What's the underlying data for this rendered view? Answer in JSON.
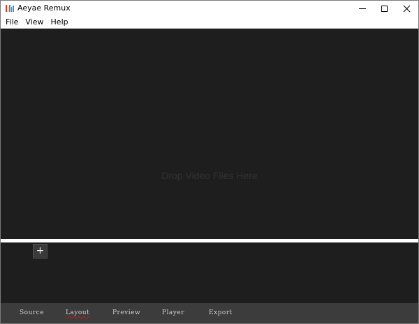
{
  "window": {
    "title": "Aeyae Remux",
    "icon": "app-icon",
    "controls": {
      "minimize": "minimize-icon",
      "maximize": "maximize-icon",
      "close": "close-icon"
    }
  },
  "menu": {
    "items": [
      {
        "label": "File"
      },
      {
        "label": "View"
      },
      {
        "label": "Help"
      }
    ]
  },
  "drop_area": {
    "hint": "Drop Video Files Here"
  },
  "tracks": {
    "add_label": "+"
  },
  "tabs": [
    {
      "label": "Source"
    },
    {
      "label": "Layout"
    },
    {
      "label": "Preview"
    },
    {
      "label": "Player"
    },
    {
      "label": "Export"
    }
  ],
  "colors": {
    "background": "#1e1e1e",
    "tab_bar": "#3c3c3c",
    "tab_text": "#d0d0d0",
    "drop_hint": "#323232",
    "app_icon": [
      "#d93a3a",
      "#f0a020",
      "#3a8ee0",
      "#3a8ee0",
      "#3a8ee0"
    ]
  }
}
